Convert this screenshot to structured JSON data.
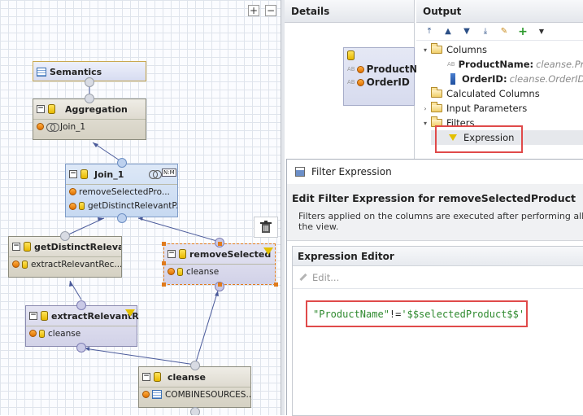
{
  "canvas": {
    "toolbar_icons": [
      "zoom-fit-icon",
      "collapse-icon"
    ],
    "nodes": {
      "semantics": {
        "title": "Semantics"
      },
      "aggregation": {
        "title": "Aggregation",
        "rows": [
          "Join_1"
        ]
      },
      "join": {
        "title": "Join_1",
        "badge": "N:M",
        "rows": [
          "removeSelectedPro...",
          "getDistinctRelevantP..."
        ]
      },
      "get_distinct": {
        "title": "getDistinctRelevа",
        "rows": [
          "extractRelevantRec..."
        ]
      },
      "remove_selected": {
        "title": "removeSelected",
        "rows": [
          "cleanse"
        ]
      },
      "extract_relevant": {
        "title": "extractRelevantR",
        "rows": [
          "cleanse"
        ]
      },
      "cleanse": {
        "title": "cleanse",
        "rows": [
          "COMBINESOURCES..."
        ]
      }
    }
  },
  "details": {
    "title": "Details",
    "fields": [
      "ProductN",
      "OrderID"
    ]
  },
  "output": {
    "title": "Output",
    "tree": {
      "columns_label": "Columns",
      "columns": [
        {
          "name": "ProductName:",
          "source": "cleanse.Prod"
        },
        {
          "name": "OrderID:",
          "source": "cleanse.OrderID"
        }
      ],
      "calculated_columns": "Calculated Columns",
      "input_parameters": "Input Parameters",
      "filters": "Filters",
      "expression": "Expression"
    }
  },
  "dialog": {
    "window_title": "Filter Expression",
    "heading": "Edit Filter Expression for removeSelectedProduct",
    "description": "Filters applied on the columns are executed after performing all the view.",
    "editor_title": "Expression Editor",
    "edit_label": "Edit...",
    "expression": {
      "column": "\"ProductName\"",
      "operator": "!=",
      "value": "'$$selectedProduct$$'"
    }
  },
  "colors": {
    "highlight_red": "#e04a4a",
    "selection_orange": "#e07b1c",
    "string_green": "#2f8a2f"
  }
}
